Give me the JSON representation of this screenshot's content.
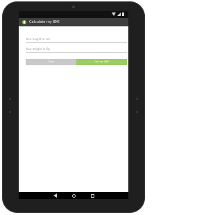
{
  "colors": {
    "device_bezel": "#1f1f1f",
    "status_bar": "#111111",
    "app_bar": "#3e3e3e",
    "accent_green": "#9ccc65",
    "clear_button": "#c9c9c9",
    "screen_background": "#ffffff"
  },
  "status_bar": {
    "icons": [
      "wifi-icon",
      "signal-icon",
      "battery-icon"
    ],
    "time": ""
  },
  "app_bar": {
    "icon": "app-logo-icon",
    "title": "Calculate my BMI"
  },
  "form": {
    "height_placeholder": "Your height in cm",
    "height_value": "",
    "weight_placeholder": "Your weight in Kg",
    "weight_value": ""
  },
  "buttons": {
    "clear_label": "Clear",
    "calculate_label": "Get my BMI"
  },
  "nav_bar": {
    "icons": [
      "back-icon",
      "home-icon",
      "recents-icon"
    ]
  }
}
